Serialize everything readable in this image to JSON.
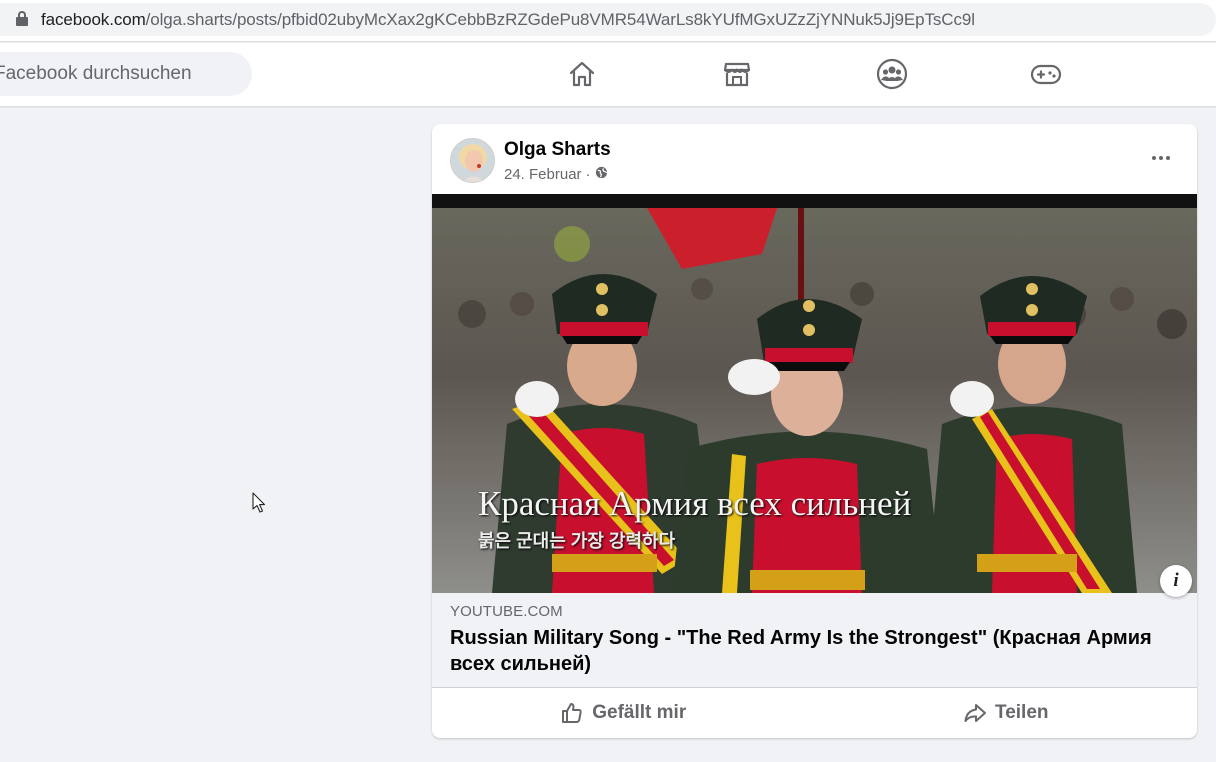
{
  "browser": {
    "url_domain": "facebook.com",
    "url_path": "/olga.sharts/posts/pfbid02ubyMcXax2gKCebbBzRZGdePu8VMR54WarLs8kYUfMGxUZzZjYNNuk5Jj9EpTsCc9l",
    "lock_icon": "lock-icon"
  },
  "nav": {
    "search_placeholder": "Facebook durchsuchen",
    "icons": [
      "home-icon",
      "marketplace-icon",
      "groups-icon",
      "gaming-icon"
    ]
  },
  "post": {
    "author": "Olga Sharts",
    "date": "24. Februar",
    "separator": " · ",
    "privacy_icon": "globe-icon",
    "video_subtitle_ru": "Красная Армия всех сильней",
    "video_subtitle_ko": "붉은 군대는 가장 강력하다",
    "link": {
      "domain": "YOUTUBE.COM",
      "title": "Russian Military Song - \"The Red Army Is the Strongest\" (Красная Армия всех сильней)"
    },
    "actions": {
      "like": "Gefällt mir",
      "share": "Teilen"
    }
  },
  "colors": {
    "fb_bg": "#f0f2f5",
    "text_secondary": "#65676b",
    "uniform_red": "#c8102e",
    "uniform_green": "#2d3b2d"
  }
}
